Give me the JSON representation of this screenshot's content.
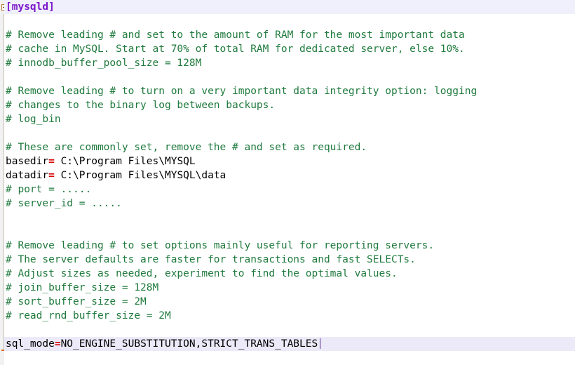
{
  "app": {
    "kind": "text-editor",
    "file_type": "mysql-ini-config",
    "fold_marker": "collapse-box",
    "colors": {
      "background": "#ffffff",
      "comment": "#1f7a3d",
      "section": "#7b17c9",
      "operator": "#d60000",
      "text": "#000000",
      "current_line_highlight": "#eceaf8",
      "section_line_highlight": "#eff0fb",
      "gutter": "#f2f2f2",
      "fold_box_border": "#c0772e",
      "caret": "#5a2a8a"
    }
  },
  "document": {
    "lines": [
      {
        "type": "section",
        "text": "[mysqld]",
        "highlight": "section"
      },
      {
        "type": "blank",
        "text": ""
      },
      {
        "type": "comment",
        "text": "# Remove leading # and set to the amount of RAM for the most important data"
      },
      {
        "type": "comment",
        "text": "# cache in MySQL. Start at 70% of total RAM for dedicated server, else 10%."
      },
      {
        "type": "comment",
        "text": "# innodb_buffer_pool_size = 128M"
      },
      {
        "type": "blank",
        "text": ""
      },
      {
        "type": "comment",
        "text": "# Remove leading # to turn on a very important data integrity option: logging"
      },
      {
        "type": "comment",
        "text": "# changes to the binary log between backups."
      },
      {
        "type": "comment",
        "text": "# log_bin"
      },
      {
        "type": "blank",
        "text": ""
      },
      {
        "type": "comment",
        "text": "# These are commonly set, remove the # and set as required."
      },
      {
        "type": "setting",
        "key": "basedir",
        "op": "=",
        "value": " C:\\Program Files\\MYSQL"
      },
      {
        "type": "setting",
        "key": "datadir",
        "op": "=",
        "value": " C:\\Program Files\\MYSQL\\data"
      },
      {
        "type": "comment",
        "text": "# port = ....."
      },
      {
        "type": "comment",
        "text": "# server_id = ....."
      },
      {
        "type": "blank",
        "text": ""
      },
      {
        "type": "blank",
        "text": ""
      },
      {
        "type": "comment",
        "text": "# Remove leading # to set options mainly useful for reporting servers."
      },
      {
        "type": "comment",
        "text": "# The server defaults are faster for transactions and fast SELECTs."
      },
      {
        "type": "comment",
        "text": "# Adjust sizes as needed, experiment to find the optimal values."
      },
      {
        "type": "comment",
        "text": "# join_buffer_size = 128M"
      },
      {
        "type": "comment",
        "text": "# sort_buffer_size = 2M"
      },
      {
        "type": "comment",
        "text": "# read_rnd_buffer_size = 2M"
      },
      {
        "type": "blank",
        "text": ""
      },
      {
        "type": "setting",
        "key": "sql_mode",
        "op": "=",
        "value": "NO_ENGINE_SUBSTITUTION,STRICT_TRANS_TABLES",
        "highlight": "current",
        "caret": true
      }
    ]
  }
}
